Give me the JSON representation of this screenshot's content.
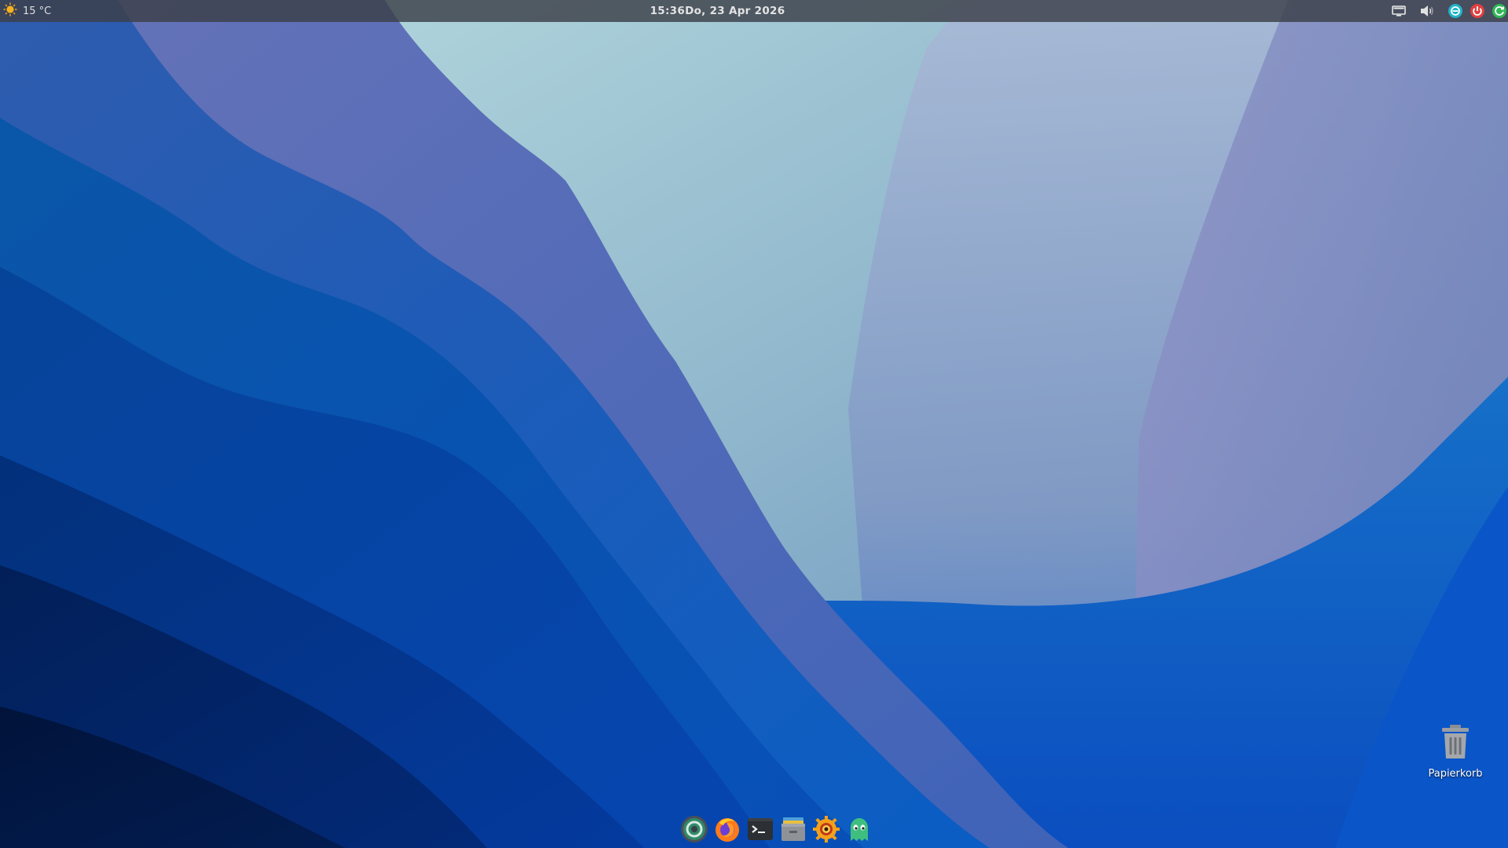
{
  "top_panel": {
    "weather": {
      "icon": "sun-icon",
      "temperature": "15 °C"
    },
    "clock": {
      "time": "15:36",
      "date": "Do, 23 Apr 2026"
    },
    "tray": [
      {
        "name": "display-icon"
      },
      {
        "name": "volume-icon"
      },
      {
        "name": "lock-screen-icon",
        "color": "#1fb5c9"
      },
      {
        "name": "power-icon",
        "color": "#e04040"
      },
      {
        "name": "restart-icon",
        "color": "#2fb857"
      }
    ]
  },
  "desktop_icons": {
    "trash": {
      "icon": "trash-icon",
      "label": "Papierkorb"
    }
  },
  "dock": {
    "items": [
      {
        "name": "app-menu-icon"
      },
      {
        "name": "firefox-icon"
      },
      {
        "name": "terminal-icon"
      },
      {
        "name": "file-manager-icon"
      },
      {
        "name": "image-viewer-icon"
      },
      {
        "name": "ghost-app-icon"
      }
    ]
  },
  "colors": {
    "panel_bg": "#3c4048",
    "accent_blue": "#0a5bd0",
    "wallpaper_light": "#a8cfd8",
    "wallpaper_dark": "#031a4a"
  }
}
